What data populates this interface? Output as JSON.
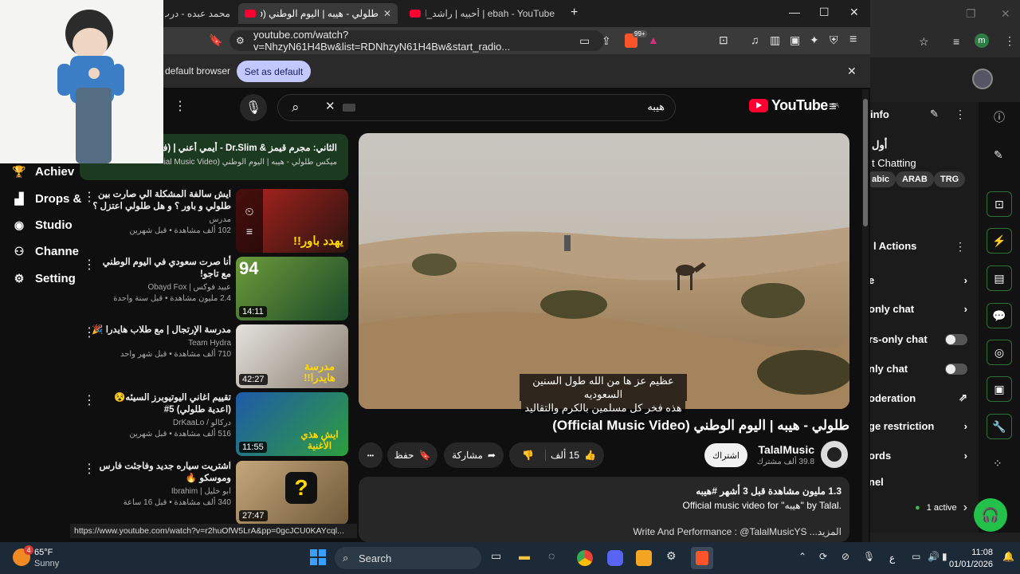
{
  "background_app": {
    "menu": [
      {
        "label": "Achiev",
        "icon": "trophy-icon"
      },
      {
        "label": "Drops &",
        "icon": "chart-icon"
      },
      {
        "label": "Studio",
        "icon": "studio-icon"
      },
      {
        "label": "Channe",
        "icon": "people-icon"
      },
      {
        "label": "Setting",
        "icon": "gear-icon"
      }
    ]
  },
  "right_panel": {
    "info_title": "info",
    "line1": "أول",
    "chatting": "t Chatting",
    "chips": [
      "abic",
      "ARAB",
      "TRG"
    ],
    "actions_title": "l Actions",
    "items": [
      {
        "label": "e",
        "control": "chevron"
      },
      {
        "label": "only chat",
        "control": "chevron"
      },
      {
        "label": "rs-only chat",
        "control": "toggle"
      },
      {
        "label": "nly chat",
        "control": "toggle"
      },
      {
        "label": "oderation",
        "control": "external"
      },
      {
        "label": "ge restriction",
        "control": "chevron"
      },
      {
        "label": "ords",
        "control": "chevron"
      },
      {
        "label": "nel",
        "control": "none"
      }
    ],
    "active": "1 active",
    "profile_initial": "m"
  },
  "browser": {
    "tabs": [
      {
        "label": "محمد عبده - درب الـ",
        "active": false
      },
      {
        "label": "طلولي - هيبه | اليوم الوطني (deo",
        "active": true
      },
      {
        "label": "ebah - YouTube | أحبيه | راشد_الماجد#",
        "active": false
      }
    ],
    "new_tab": "+",
    "url": "youtube.com/watch?v=NhzyN61H4Bw&list=RDNhzyN61H4Bw&start_radio...",
    "infobar_text": "default browser",
    "set_default": "Set as default",
    "badge": "99+"
  },
  "youtube": {
    "logo": "YouTube",
    "region": "SA",
    "search_query": "هيبه",
    "now_playing": {
      "title": "الثاني: مجرم قيمز & Dr.Slim - أيمي أعني | (فيديو كليب",
      "sub": "ميكس طلولي - هيبه | اليوم الوطني (Official Music Video)"
    },
    "recommendations": [
      {
        "title": "ايش سالفة المشكلة الي صارت بين طلولي و باور ؟ و هل طلولي اعتزل ؟",
        "channel": "مدرس",
        "meta": "102 ألف مشاهدة • قبل شهرين",
        "duration": "",
        "thumb_text": "يهدد باور!!"
      },
      {
        "title": "أنا صرت سعودي في اليوم الوطني مع تاجو!",
        "channel": "عبيد فوكس | Obayd Fox",
        "meta": "2.4 مليون مشاهدة • قبل سنة واحدة",
        "duration": "14:11",
        "thumb_text": "94"
      },
      {
        "title": "مدرسة الإرتجال | مع طلاب هايدرا 🎉",
        "channel": "Team Hydra",
        "meta": "710 ألف مشاهدة • قبل شهر واحد",
        "duration": "42:27",
        "thumb_text": "مدرسة هايدرا!!"
      },
      {
        "title": "تقييم اغاني اليوتيوبرز السيئه😵 (اعدية طلولي) 5#",
        "channel": "دركالو / DrKaaLo",
        "meta": "516 ألف مشاهدة • قبل شهرين",
        "duration": "11:55",
        "thumb_text": "ايش هذي الأغنية"
      },
      {
        "title": "اشتريت سياره جديد وفاجئت فارس وموسكو 🔥",
        "channel": "ابو خليل | Ibrahim",
        "meta": "340 ألف مشاهدة • قبل 16 ساعة",
        "duration": "27:47",
        "thumb_text": "?"
      }
    ],
    "status_url": "https://www.youtube.com/watch?v=r2huOfW5LrA&pp=0gcJCU0KAYcql...",
    "video": {
      "caption_line1": "عظيم عز ها من الله طول السنين السعوديه",
      "caption_line2": "هذه فخر كل مسلمين بالكرم والتقاليد",
      "title": "طلولي - هيبه | اليوم الوطني (Official Music Video)",
      "channel": "TalalMusic",
      "subscribers": "39.8 ألف مشترك",
      "subscribe": "اشتراك",
      "likes": "15 ألف",
      "share": "مشاركة",
      "save": "حفظ",
      "more": "•••",
      "desc_stats": "1.3 مليون مشاهدة  قبل 3 أشهر  #هيبه",
      "desc_line": "Official music video for \"هيبه\" by Talal.",
      "desc_credits": "Write And Performance : @TalalMusicYS ...المزيد"
    }
  },
  "taskbar": {
    "weather_temp": "65°F",
    "weather_desc": "Sunny",
    "weather_badge": "4",
    "search": "Search",
    "lang": "ع",
    "time": "11:08",
    "date": "01/01/2026"
  }
}
